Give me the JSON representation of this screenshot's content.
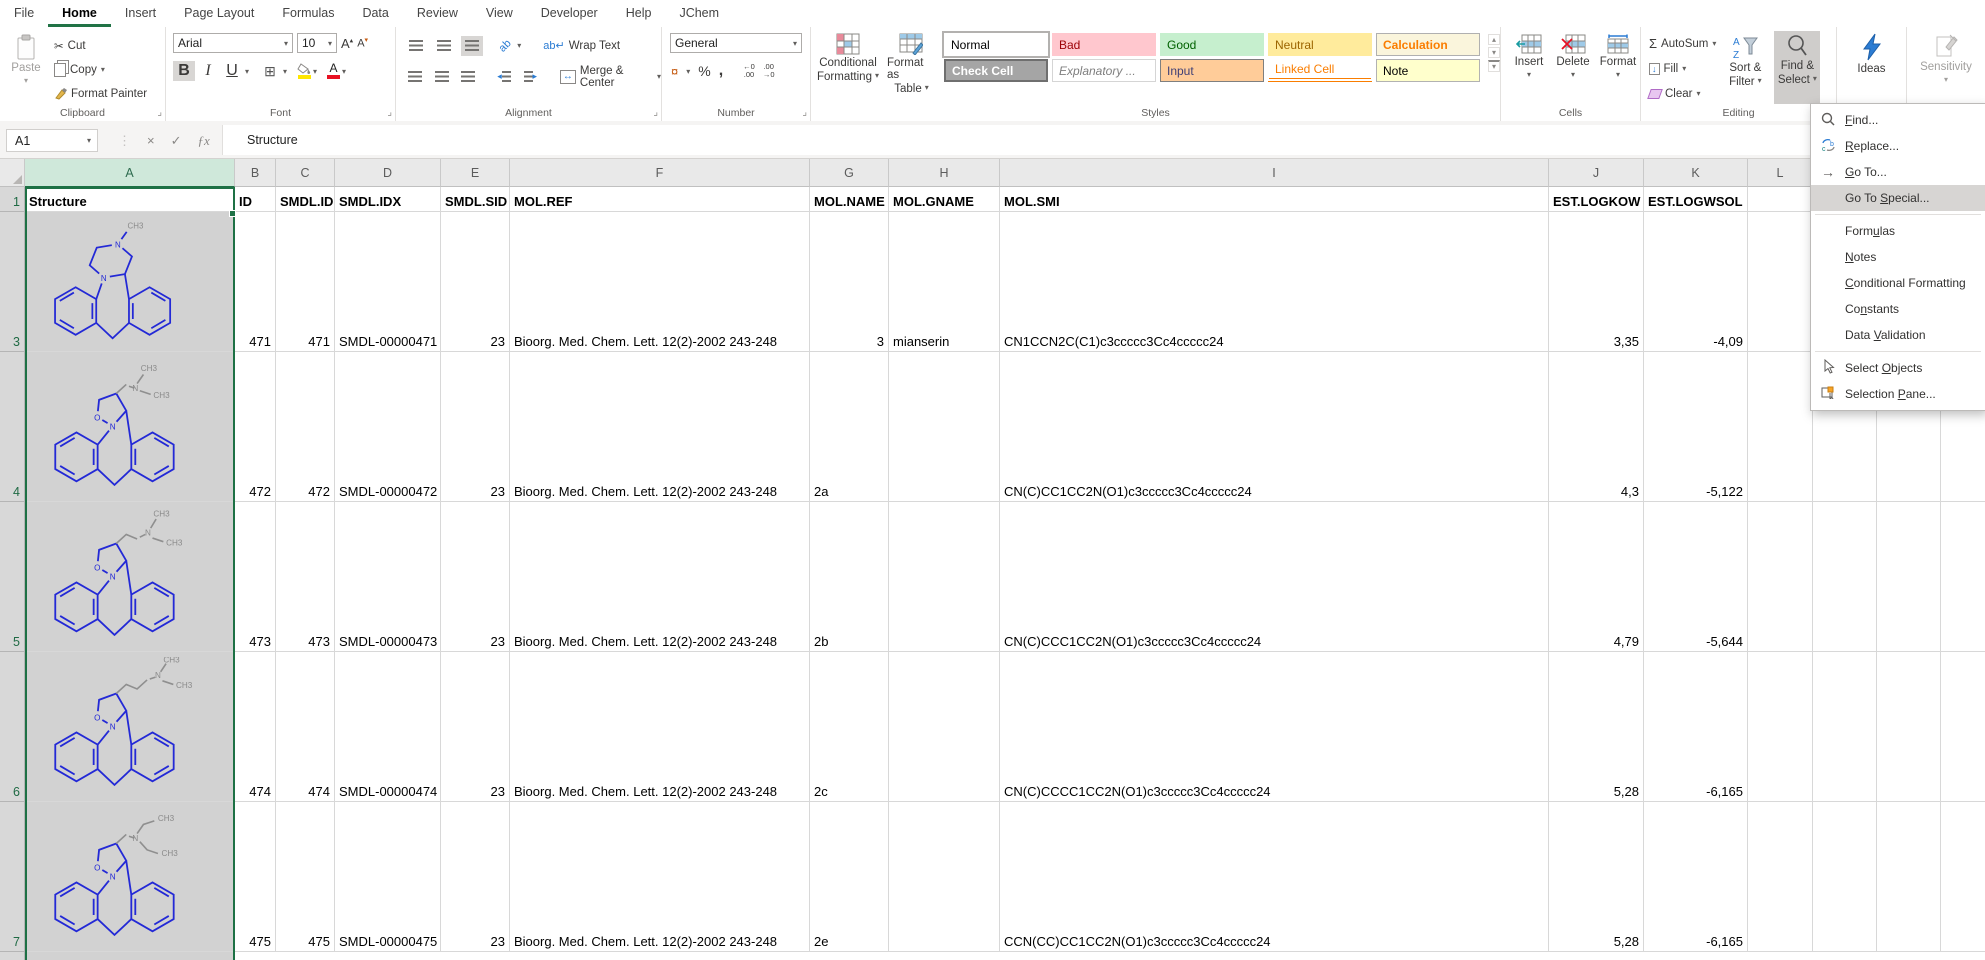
{
  "ribbon": {
    "tabs": [
      {
        "label": "File"
      },
      {
        "label": "Home"
      },
      {
        "label": "Insert"
      },
      {
        "label": "Page Layout"
      },
      {
        "label": "Formulas"
      },
      {
        "label": "Data"
      },
      {
        "label": "Review"
      },
      {
        "label": "View"
      },
      {
        "label": "Developer"
      },
      {
        "label": "Help"
      },
      {
        "label": "JChem"
      }
    ],
    "active_tab": "Home",
    "clipboard": {
      "label": "Clipboard",
      "paste": "Paste",
      "cut": "Cut",
      "copy": "Copy",
      "format_painter": "Format Painter"
    },
    "font": {
      "label": "Font",
      "family": "Arial",
      "size": "10",
      "bold": "B",
      "italic": "I",
      "underline": "U"
    },
    "alignment": {
      "label": "Alignment",
      "wrap": "Wrap Text",
      "merge": "Merge & Center",
      "orientation": "ab"
    },
    "number": {
      "label": "Number",
      "format": "General",
      "percent": "%",
      "comma": ",",
      "currency": "¤"
    },
    "styles": {
      "label": "Styles",
      "cf1": "Conditional",
      "cf2": "Formatting",
      "fat1": "Format as",
      "fat2": "Table",
      "chips_row1": [
        "Normal",
        "Bad",
        "Good",
        "Neutral",
        "Calculation"
      ],
      "chips_row2": [
        "Check Cell",
        "Explanatory ...",
        "Input",
        "Linked Cell",
        "Note"
      ]
    },
    "cells": {
      "label": "Cells",
      "insert": "Insert",
      "delete": "Delete",
      "format": "Format"
    },
    "editing": {
      "label": "Editing",
      "autosum": "AutoSum",
      "fill": "Fill",
      "clear": "Clear",
      "sort1": "Sort &",
      "sort2": "Filter",
      "find1": "Find &",
      "find2": "Select"
    },
    "ideas": {
      "label": "Ideas"
    },
    "sensitivity": {
      "label": "Sensitivity"
    },
    "accent_green": "#217346"
  },
  "formula_bar": {
    "name_box": "A1",
    "value": "Structure"
  },
  "menu": {
    "items": [
      {
        "label": "Find...",
        "u": 0,
        "icon": "find-icon"
      },
      {
        "label": "Replace...",
        "u": 0,
        "icon": "replace-icon"
      },
      {
        "label": "Go To...",
        "u": 0,
        "icon": "goto-icon"
      },
      {
        "label": "Go To Special...",
        "u": 6,
        "highlighted": true
      },
      {
        "separator": true
      },
      {
        "label": "Formulas",
        "u": 4
      },
      {
        "label": "Notes",
        "u": 0
      },
      {
        "label": "Conditional Formatting",
        "u": 0
      },
      {
        "label": "Constants",
        "u": 2
      },
      {
        "label": "Data Validation",
        "u": 5
      },
      {
        "separator": true
      },
      {
        "label": "Select Objects",
        "u": 7,
        "icon": "cursor-icon"
      },
      {
        "label": "Selection Pane...",
        "u": 10,
        "icon": "pane-icon"
      }
    ]
  },
  "sheet": {
    "column_letters": [
      "A",
      "B",
      "C",
      "D",
      "E",
      "F",
      "G",
      "H",
      "I",
      "J",
      "K",
      "L"
    ],
    "row_numbers": [
      "1",
      "3",
      "4",
      "5",
      "6",
      "7"
    ],
    "headers": [
      "Structure",
      "ID",
      "SMDL.ID",
      "SMDL.IDX",
      "SMDL.SID",
      "MOL.REF",
      "MOL.NAME",
      "MOL.GNAME",
      "MOL.SMI",
      "EST.LOGKOW",
      "EST.LOGWSOL"
    ],
    "molecule_labels": {
      "n": "N",
      "o": "O",
      "ch3": "CH3"
    },
    "rows": [
      {
        "row_num": "3",
        "id": "471",
        "smdl_id": "471",
        "smdl_idx": "SMDL-00000471",
        "smdl_sid": "23",
        "mol_ref": "Bioorg. Med. Chem. Lett. 12(2)-2002 243-248",
        "mol_name": "3",
        "mol_gname": "mianserin",
        "mol_smi": "CN1CCN2C(C1)c3ccccc3Cc4ccccc24",
        "est_logkow": "3,35",
        "est_logwsol": "-4,09"
      },
      {
        "row_num": "4",
        "id": "472",
        "smdl_id": "472",
        "smdl_idx": "SMDL-00000472",
        "smdl_sid": "23",
        "mol_ref": "Bioorg. Med. Chem. Lett. 12(2)-2002 243-248",
        "mol_name": "2a",
        "mol_gname": "",
        "mol_smi": "CN(C)CC1CC2N(O1)c3ccccc3Cc4ccccc24",
        "est_logkow": "4,3",
        "est_logwsol": "-5,122"
      },
      {
        "row_num": "5",
        "id": "473",
        "smdl_id": "473",
        "smdl_idx": "SMDL-00000473",
        "smdl_sid": "23",
        "mol_ref": "Bioorg. Med. Chem. Lett. 12(2)-2002 243-248",
        "mol_name": "2b",
        "mol_gname": "",
        "mol_smi": "CN(C)CCC1CC2N(O1)c3ccccc3Cc4ccccc24",
        "est_logkow": "4,79",
        "est_logwsol": "-5,644"
      },
      {
        "row_num": "6",
        "id": "474",
        "smdl_id": "474",
        "smdl_idx": "SMDL-00000474",
        "smdl_sid": "23",
        "mol_ref": "Bioorg. Med. Chem. Lett. 12(2)-2002 243-248",
        "mol_name": "2c",
        "mol_gname": "",
        "mol_smi": "CN(C)CCCC1CC2N(O1)c3ccccc3Cc4ccccc24",
        "est_logkow": "5,28",
        "est_logwsol": "-6,165"
      },
      {
        "row_num": "7",
        "id": "475",
        "smdl_id": "475",
        "smdl_idx": "SMDL-00000475",
        "smdl_sid": "23",
        "mol_ref": "Bioorg. Med. Chem. Lett. 12(2)-2002 243-248",
        "mol_name": "2e",
        "mol_gname": "",
        "mol_smi": "CCN(CC)CC1CC2N(O1)c3ccccc3Cc4ccccc24",
        "est_logkow": "5,28",
        "est_logwsol": "-6,165"
      }
    ]
  }
}
